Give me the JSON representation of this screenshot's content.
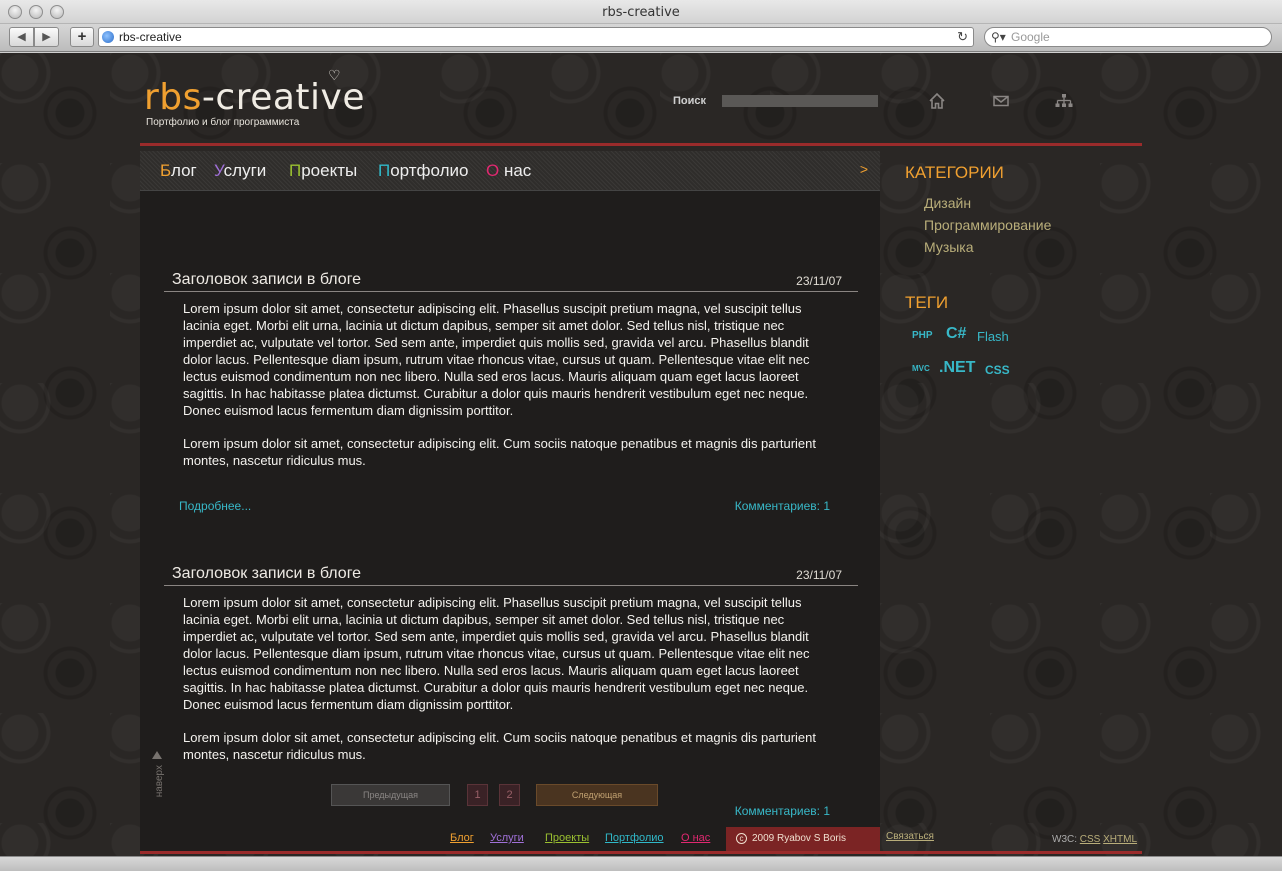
{
  "browser": {
    "window_title": "rbs-creative",
    "url": "rbs-creative",
    "search_placeholder": "Google",
    "back_glyph": "◀",
    "forward_glyph": "▶",
    "add_glyph": "+",
    "reload_glyph": "↻"
  },
  "header": {
    "logo_part1": "rbs",
    "logo_part2": "-creative",
    "tagline": "Портфолио и блог программиста",
    "search_label": "Поиск",
    "icons": [
      "home-icon",
      "mail-icon",
      "sitemap-icon"
    ]
  },
  "menu": {
    "items": [
      {
        "first": "Б",
        "rest": "лог",
        "color": "#f0a030"
      },
      {
        "first": "У",
        "rest": "слуги",
        "color": "#a070d8"
      },
      {
        "first": "П",
        "rest": "роекты",
        "color": "#9ac030"
      },
      {
        "first": "П",
        "rest": "ортфолио",
        "color": "#30b8c8"
      },
      {
        "first": "О",
        "rest": " нас",
        "color": "#e02870"
      }
    ],
    "arrow": ">"
  },
  "posts": [
    {
      "title": "Заголовок записи в блоге",
      "date": "23/11/07",
      "para1": "Lorem ipsum dolor sit amet, consectetur adipiscing elit. Phasellus suscipit pretium magna, vel suscipit tellus lacinia eget. Morbi elit urna, lacinia ut dictum dapibus, semper sit amet dolor. Sed tellus nisl, tristique nec imperdiet ac, vulputate vel tortor. Sed sem ante, imperdiet quis mollis sed, gravida vel arcu. Phasellus blandit dolor lacus. Pellentesque diam ipsum, rutrum vitae rhoncus vitae, cursus ut quam. Pellentesque vitae elit nec lectus euismod condimentum non nec libero. Nulla sed eros lacus. Mauris aliquam quam eget lacus laoreet sagittis. In hac habitasse platea dictumst. Curabitur a dolor quis mauris hendrerit vestibulum eget nec neque. Donec euismod lacus fermentum diam dignissim porttitor.",
      "para2": "Lorem ipsum dolor sit amet, consectetur adipiscing elit. Cum sociis natoque penatibus et magnis dis parturient montes, nascetur ridiculus mus.",
      "more": "Подробнее...",
      "comments": "Комментариев: 1"
    },
    {
      "title": "Заголовок записи в блоге",
      "date": "23/11/07",
      "para1": "Lorem ipsum dolor sit amet, consectetur adipiscing elit. Phasellus suscipit pretium magna, vel suscipit tellus lacinia eget. Morbi elit urna, lacinia ut dictum dapibus, semper sit amet dolor. Sed tellus nisl, tristique nec imperdiet ac, vulputate vel tortor. Sed sem ante, imperdiet quis mollis sed, gravida vel arcu. Phasellus blandit dolor lacus. Pellentesque diam ipsum, rutrum vitae rhoncus vitae, cursus ut quam. Pellentesque vitae elit nec lectus euismod condimentum non nec libero. Nulla sed eros lacus. Mauris aliquam quam eget lacus laoreet sagittis. In hac habitasse platea dictumst. Curabitur a dolor quis mauris hendrerit vestibulum eget nec neque. Donec euismod lacus fermentum diam dignissim porttitor.",
      "para2": "Lorem ipsum dolor sit amet, consectetur adipiscing elit. Cum sociis natoque penatibus et magnis dis parturient montes, nascetur ridiculus mus.",
      "comments": "Комментариев: 1"
    }
  ],
  "pager": {
    "prev": "Предыдущая",
    "pages": [
      "1",
      "2"
    ],
    "next": "Следующая"
  },
  "to_top": "наверх",
  "sidebar": {
    "categories_title": "КАТЕГОРИИ",
    "categories": [
      "Дизайн",
      "Программирование",
      "Музыка"
    ],
    "tags_title": "ТЕГИ",
    "tags": [
      "PHP",
      "C#",
      "Flash",
      "MVC",
      ".NET",
      "CSS"
    ]
  },
  "footer": {
    "nav": [
      {
        "label": "Блог",
        "color": "#f0a030"
      },
      {
        "label": "Услуги",
        "color": "#a070d8"
      },
      {
        "label": "Проекты",
        "color": "#9ac030"
      },
      {
        "label": "Портфолио",
        "color": "#30b8c8"
      },
      {
        "label": "О нас",
        "color": "#e02870"
      }
    ],
    "copyright_symbol": "c",
    "copyright": "2009 Ryabov S Boris",
    "contact": "Связаться",
    "w3c_label": "W3C:",
    "w3c_css": "CSS",
    "w3c_xhtml": "XHTML"
  },
  "colors": {
    "accent_orange": "#f0a030",
    "link_cyan": "#38b8c8",
    "brand_red": "#9a2b2b"
  }
}
